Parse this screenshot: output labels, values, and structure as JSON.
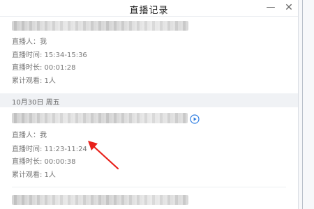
{
  "window": {
    "title": "直播记录"
  },
  "records": [
    {
      "host": "直播人：我",
      "time": "直播时间: 15:34-15:36",
      "duration": "直播时长: 00:01:28",
      "viewers": "累计观看: 1人"
    },
    {
      "host": "直播人：我",
      "time": "直播时间: 11:23-11:24",
      "duration": "直播时长: 00:00:38",
      "viewers": "累计观看: 1人"
    }
  ],
  "date_group": "10月30日 周五",
  "colors": {
    "annotation_arrow": "#e8201a",
    "play_icon": "#2f7de1"
  },
  "icons": {
    "minimize": "minimize-icon",
    "close": "close-icon",
    "play": "play-icon"
  }
}
